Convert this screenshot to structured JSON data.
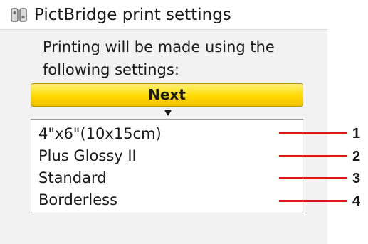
{
  "header": {
    "title": "PictBridge print settings",
    "icon": "printer-settings-icon"
  },
  "message": "Printing will be made using the\nfollowing settings:",
  "next_button": {
    "label": "Next",
    "color": "#ffd900"
  },
  "settings": [
    {
      "value": "4\"x6\"(10x15cm)",
      "callout": "1"
    },
    {
      "value": "Plus Glossy II",
      "callout": "2"
    },
    {
      "value": "Standard",
      "callout": "3"
    },
    {
      "value": "Borderless",
      "callout": "4"
    }
  ],
  "callout_color": "#e01515"
}
